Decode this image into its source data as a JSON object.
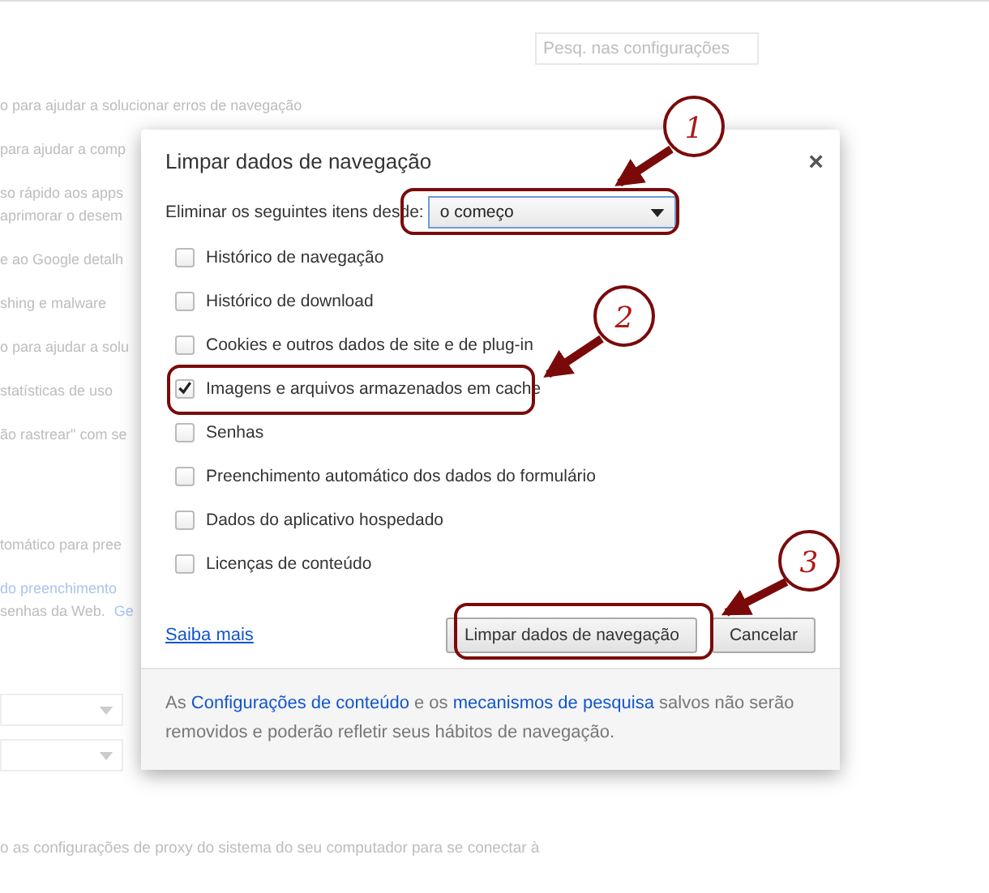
{
  "settings_page": {
    "search": {
      "placeholder": "Pesq. nas configurações"
    },
    "lines": [
      {
        "text": "o para ajudar a solucionar erros de navegação",
        "kind": "text"
      },
      {
        "text": "para ajudar a comp",
        "kind": "text"
      },
      {
        "text": "so rápido aos apps",
        "kind": "text"
      },
      {
        "text": "aprimorar o desem",
        "kind": "text"
      },
      {
        "text": "e ao Google detalh",
        "kind": "text"
      },
      {
        "text": "shing e malware",
        "kind": "text"
      },
      {
        "text": "o para ajudar a solu",
        "kind": "text"
      },
      {
        "text": "statísticas de uso",
        "kind": "text"
      },
      {
        "text": "ão rastrear\" com se",
        "kind": "text"
      },
      {
        "text": "tomático para pree",
        "kind": "text"
      },
      {
        "text": "do preenchimento",
        "kind": "link"
      },
      {
        "text": "senhas da Web.",
        "kind": "text",
        "link": "Ge"
      }
    ],
    "footer_line": "o as configurações de proxy do sistema do seu computador para se conectar à"
  },
  "dialog": {
    "title": "Limpar dados de navegação",
    "close": "×",
    "period_label": "Eliminar os seguintes itens desde:",
    "period_value": "o começo",
    "items": [
      {
        "label": "Histórico de navegação",
        "checked": false
      },
      {
        "label": "Histórico de download",
        "checked": false
      },
      {
        "label": "Cookies e outros dados de site e de plug-in",
        "checked": false
      },
      {
        "label": "Imagens e arquivos armazenados em cache",
        "checked": true
      },
      {
        "label": "Senhas",
        "checked": false
      },
      {
        "label": "Preenchimento automático dos dados do formulário",
        "checked": false
      },
      {
        "label": "Dados do aplicativo hospedado",
        "checked": false
      },
      {
        "label": "Licenças de conteúdo",
        "checked": false
      }
    ],
    "learn_more": "Saiba mais",
    "primary_button": "Limpar dados de navegação",
    "cancel_button": "Cancelar",
    "note": [
      "As ",
      "Configurações de conteúdo",
      " e os ",
      "mecanismos de pesquisa",
      " salvos não serão removidos e poderão refletir seus hábitos de navegação."
    ]
  },
  "annotations": [
    {
      "number": "1"
    },
    {
      "number": "2"
    },
    {
      "number": "3"
    }
  ]
}
